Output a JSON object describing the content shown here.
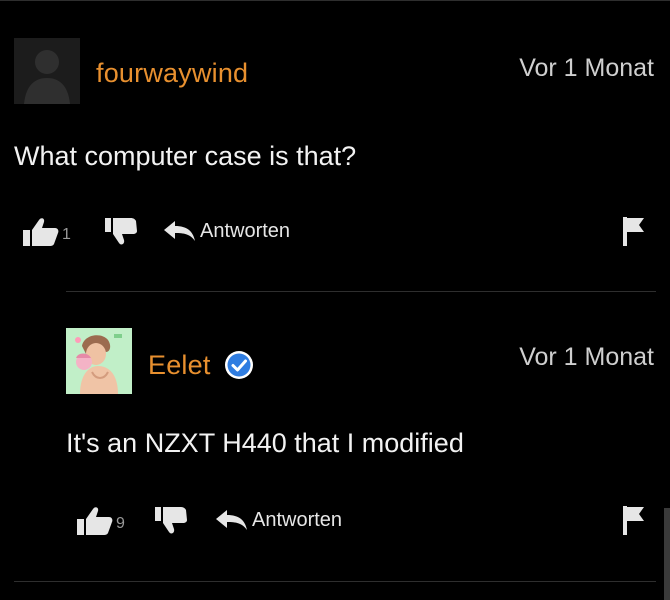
{
  "comments": [
    {
      "username": "fourwaywind",
      "timestamp": "Vor 1 Monat",
      "text": "What computer case is that?",
      "likes": "1",
      "reply_label": "Antworten",
      "avatar": "default-avatar",
      "verified": false
    },
    {
      "username": "Eelet",
      "timestamp": "Vor 1 Monat",
      "text": "It's an NZXT H440 that I modified",
      "likes": "9",
      "reply_label": "Antworten",
      "avatar": "illustrated-avatar",
      "verified": true
    }
  ],
  "colors": {
    "background": "#000000",
    "username": "#e8902f",
    "verified_badge": "#2f7de1",
    "divider": "#2e2e2e",
    "icon": "#e6e6e6",
    "count": "#999999"
  },
  "icons": [
    "thumbs-up-icon",
    "thumbs-down-icon",
    "reply-arrow-icon",
    "flag-icon",
    "verified-badge-icon"
  ]
}
